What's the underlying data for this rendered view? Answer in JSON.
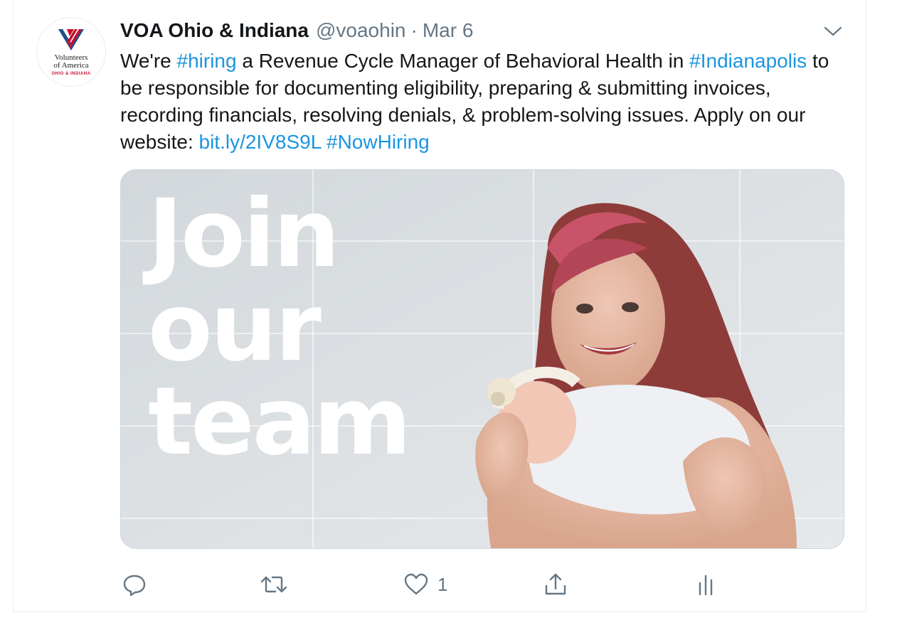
{
  "tweet": {
    "display_name": "VOA Ohio & Indiana",
    "handle": "@voaohin",
    "separator": "·",
    "date": "Mar 6",
    "avatar": {
      "line1": "Volunteers",
      "line2": "of America",
      "line3": "OHIO & INDIANA",
      "brand_red": "#c8102e",
      "brand_blue": "#1f4e8c"
    },
    "text": {
      "t1": "We're ",
      "hashtag_hiring": "#hiring",
      "t2": " a Revenue Cycle Manager of Behavioral Health in ",
      "hashtag_indianapolis": "#Indianapolis",
      "t3": " to be responsible for documenting eligibility, preparing & submitting invoices, recording financials, resolving denials, & problem-solving issues.  Apply on our website: ",
      "url": "bit.ly/2IV8S9L",
      "t4": " ",
      "hashtag_nowhiring": "#NowHiring"
    },
    "media": {
      "headline_line1": "Join",
      "headline_line2": "our",
      "headline_line3": "team"
    },
    "actions": {
      "reply_icon": "reply-icon",
      "retweet_icon": "retweet-icon",
      "like_icon": "heart-icon",
      "like_count": "1",
      "share_icon": "share-icon",
      "analytics_icon": "analytics-icon"
    },
    "colors": {
      "link": "#1b95e0",
      "secondary_text": "#657786",
      "primary_text": "#14171a"
    }
  }
}
